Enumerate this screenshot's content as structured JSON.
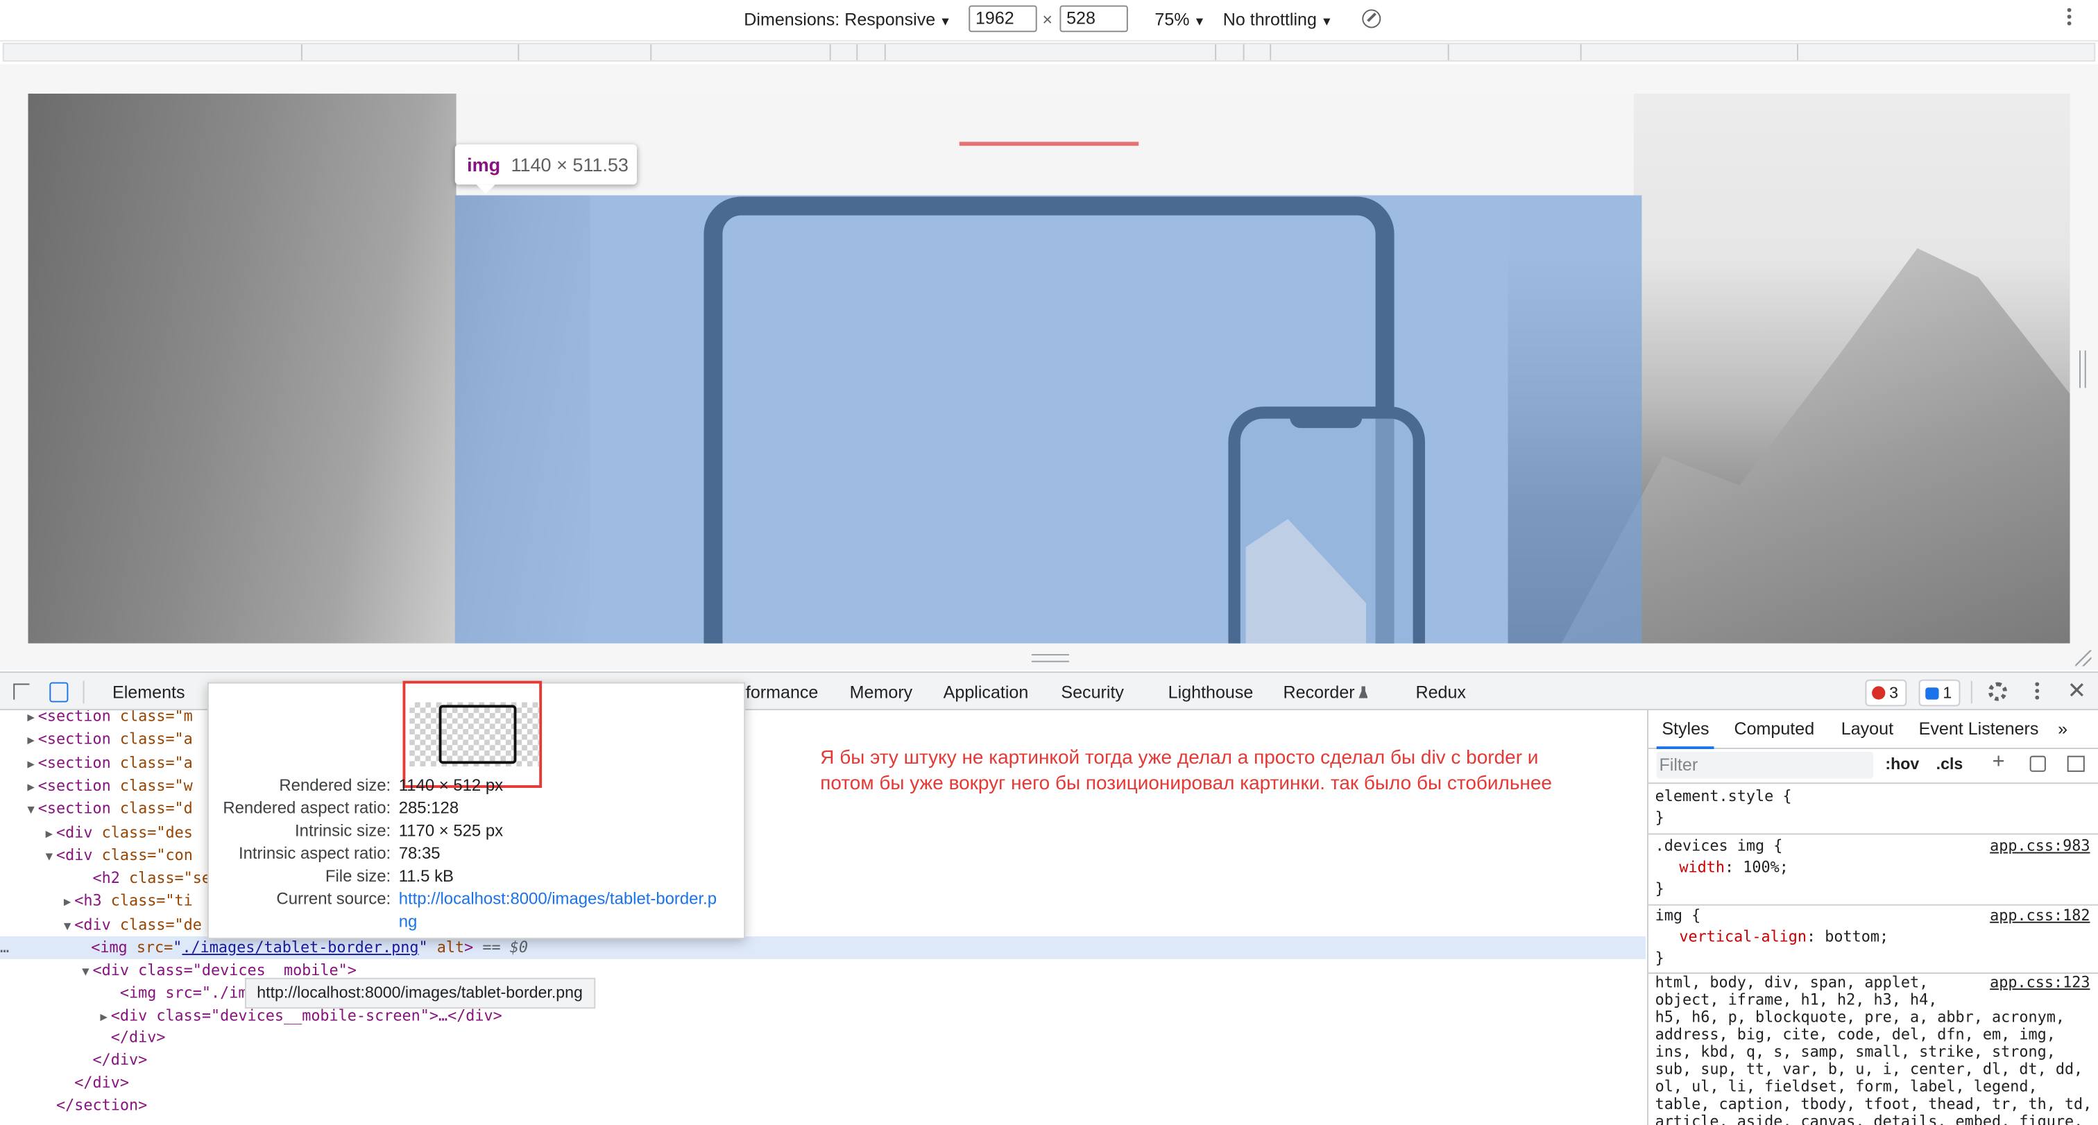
{
  "device_toolbar": {
    "dimensions_label": "Dimensions: Responsive",
    "width": "1962",
    "height": "528",
    "times": "×",
    "zoom": "75%",
    "throttling": "No throttling"
  },
  "viewport": {
    "tooltip_tag": "img",
    "tooltip_dims": "1140 × 511.53"
  },
  "devtools": {
    "tabs": [
      "Elements",
      "rformance",
      "Memory",
      "Application",
      "Security",
      "Lighthouse",
      "Recorder",
      "Redux"
    ],
    "error_count": "3",
    "message_count": "1"
  },
  "elements_tree": {
    "lines": [
      {
        "indent": "   ",
        "tri": "▶",
        "tag": "<section",
        "attr": " class=\"m"
      },
      {
        "indent": "   ",
        "tri": "▶",
        "tag": "<section",
        "attr": " class=\"a"
      },
      {
        "indent": "   ",
        "tri": "▶",
        "tag": "<section",
        "attr": " class=\"a"
      },
      {
        "indent": "   ",
        "tri": "▶",
        "tag": "<section",
        "attr": " class=\"w"
      },
      {
        "indent": "   ",
        "tri": "▼",
        "tag": "<section",
        "attr": " class=\"d"
      },
      {
        "indent": "     ",
        "tri": "▶",
        "tag": "<div",
        "attr": " class=\"des"
      },
      {
        "indent": "     ",
        "tri": "▼",
        "tag": "<div",
        "attr": " class=\"con"
      },
      {
        "indent": "         ",
        "tri": "",
        "tag": "<h2",
        "attr": " class=\"sec"
      },
      {
        "indent": "       ",
        "tri": "▶",
        "tag": "<h3",
        "attr": " class=\"ti"
      },
      {
        "indent": "       ",
        "tri": "▼",
        "tag": "<div",
        "attr": " class=\"de"
      }
    ],
    "selected": {
      "tag_open": "<img",
      "src_attr": " src=",
      "src_val": "./images/tablet-border.png",
      "alt": " alt",
      "close": ">",
      "eq": " == $0"
    },
    "after": [
      {
        "indent": "         ",
        "tri": "▼",
        "html": "<div class=\"devices  mobile\">"
      },
      {
        "indent": "            ",
        "tri": "",
        "html": "<img src=\"./im"
      },
      {
        "indent": "           ",
        "tri": "▶",
        "html": "<div class=\"devices__mobile-screen\">…</div>"
      },
      {
        "indent": "           ",
        "tri": "",
        "html": "</div>"
      },
      {
        "indent": "         ",
        "tri": "",
        "html": "</div>"
      },
      {
        "indent": "       ",
        "tri": "",
        "html": "</div>"
      },
      {
        "indent": "     ",
        "tri": "",
        "html": "</section>"
      }
    ],
    "src_tooltip": "http://localhost:8000/images/tablet-border.png"
  },
  "popover": {
    "rows": [
      {
        "label": "Rendered size:",
        "value": "1140 × 512 px"
      },
      {
        "label": "Rendered aspect ratio:",
        "value": "285:128"
      },
      {
        "label": "Intrinsic size:",
        "value": "1170 × 525 px"
      },
      {
        "label": "Intrinsic aspect ratio:",
        "value": "78:35"
      },
      {
        "label": "File size:",
        "value": "11.5 kB"
      }
    ],
    "source_label": "Current source:",
    "source_line1": "http://localhost:8000/images/tablet-border.p",
    "source_line2": "ng"
  },
  "comment": "Я бы эту штуку не картинкой тогда уже делал а просто сделал бы div с border  и потом бы уже вокруг него бы позиционировал картинки. так было бы стобильнее",
  "styles_pane": {
    "tabs": [
      "Styles",
      "Computed",
      "Layout",
      "Event Listeners",
      "»"
    ],
    "filter_placeholder": "Filter",
    "hov": ":hov",
    "cls": ".cls",
    "plus": "+",
    "element_style": "element.style {",
    "close_brace": "}",
    "rule1": {
      "selector": ".devices img {",
      "src": "app.css:983",
      "prop": "width",
      "value": ": 100%;"
    },
    "rule2": {
      "selector": "img {",
      "src": "app.css:182",
      "prop": "vertical-align",
      "value": ": bottom;"
    },
    "rule3": {
      "src": "app.css:123",
      "text": "html, body, div, span, applet,\nobject, iframe, h1, h2, h3, h4,\nh5, h6, p, blockquote, pre, a, abbr, acronym,\naddress, big, cite, code, del, dfn, em, img,\nins, kbd, q, s, samp, small, strike, strong,\nsub, sup, tt, var, b, u, i, center, dl, dt, dd,\nol, ul, li, fieldset, form, label, legend,\ntable, caption, tbody, tfoot, thead, tr, th, td,\narticle, aside, canvas, details, embed, figure,"
    }
  }
}
